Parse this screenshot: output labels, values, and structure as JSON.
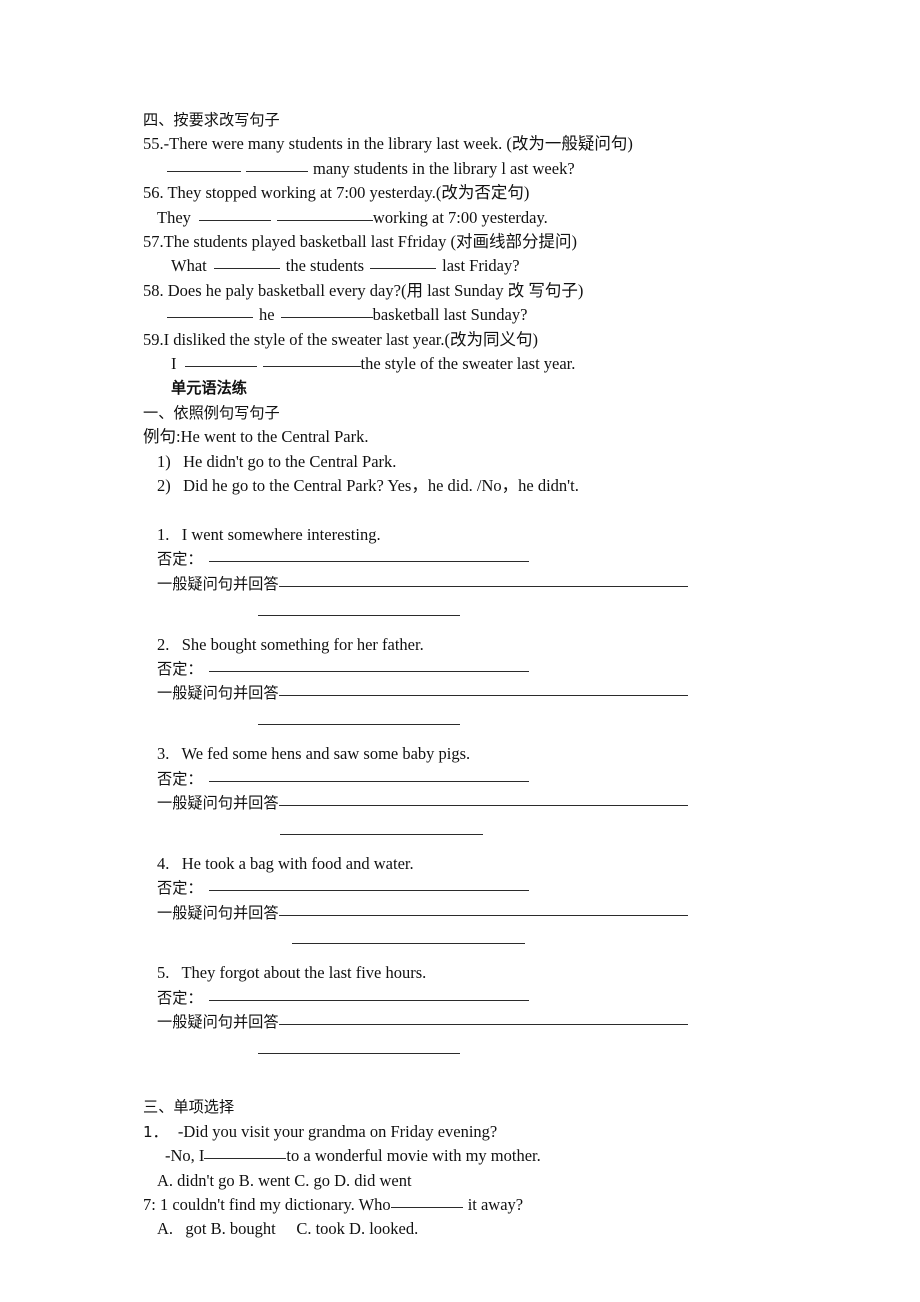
{
  "document": {
    "section_rewrite": {
      "heading": "四、按要求改写句子",
      "items": [
        {
          "prompt": "55.-There were many students in the library last week. (改为一般疑问句)",
          "answer_prefix": "",
          "answer_mid": "many students in the library l ast week?"
        },
        {
          "prompt": "56. They stopped working at 7:00 yesterday.(改为否定句)",
          "answer_prefix": "They",
          "answer_mid": "working at 7:00 yesterday."
        },
        {
          "prompt": "57.The students played basketball last Ffriday (对画线部分提问)",
          "answer_prefix": "What",
          "answer_mid": "the students",
          "answer_suffix": "last Friday?"
        },
        {
          "prompt": "58. Does he paly basketball every day?(用 last Sunday 改 写句子)",
          "answer_prefix": "",
          "answer_mid": "he",
          "answer_suffix": "basketball last Sunday?"
        },
        {
          "prompt": "59.I disliked the style of the sweater last year.(改为同义句)",
          "answer_prefix": "I",
          "answer_mid": "the style of the sweater last year."
        }
      ]
    },
    "section_grammar": {
      "title": "单元语法练",
      "heading": "一、依照例句写句子",
      "example_label": "例句:He went to the Central Park.",
      "example_lines": [
        "1)   He didn't go to the Central Park.",
        "2)   Did he go to the Central Park? Yes，he did. /No，he didn't."
      ],
      "negative_label": "否定：",
      "question_label": "一般疑问句并回答",
      "items": [
        "1.   I went somewhere interesting.",
        "2.   She bought something for her father.",
        "3.   We fed some hens and saw some baby pigs.",
        "4.   He took a bag with food and water.",
        "5.   They forgot about the last five hours."
      ]
    },
    "section_choice": {
      "heading": "三、单项选择",
      "items": [
        {
          "number": "1．",
          "stem": "-Did you visit your grandma on Friday evening?",
          "stem2_prefix": "-No, I",
          "stem2_suffix": "to a wonderful movie with my mother.",
          "options": "A. didn't go B. went C. go D. did went"
        },
        {
          "number": "7:",
          "stem_prefix": "7: 1 couldn't find my dictionary. Who",
          "stem_suffix": "it away?",
          "options": "A.   got B. bought     C. took D. looked."
        }
      ]
    }
  }
}
